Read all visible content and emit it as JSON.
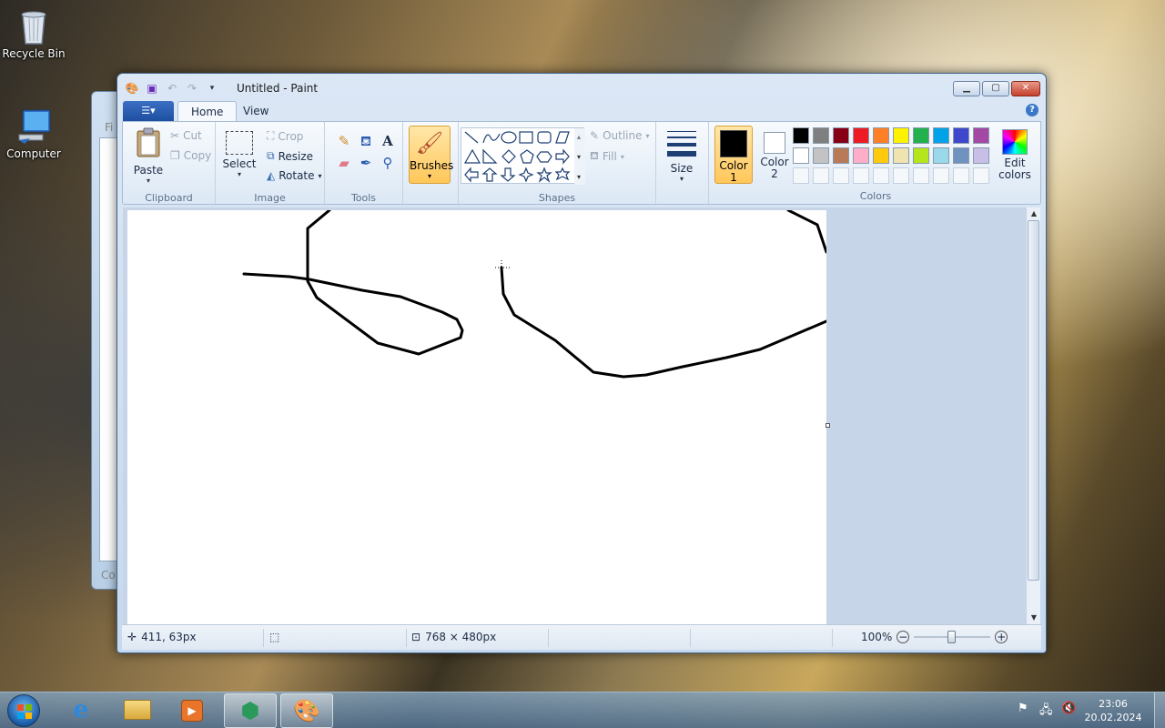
{
  "desktop": {
    "icons": [
      {
        "label": "Recycle Bin"
      },
      {
        "label": "Computer"
      }
    ]
  },
  "background_window": {
    "text_top": "Fi",
    "text_bottom": "Co"
  },
  "window": {
    "title": "Untitled - Paint",
    "tabs": [
      "Home",
      "View"
    ],
    "file_button": "☰▾",
    "help": "?"
  },
  "ribbon": {
    "clipboard": {
      "label": "Clipboard",
      "paste": "Paste",
      "cut": "Cut",
      "copy": "Copy"
    },
    "image": {
      "label": "Image",
      "select": "Select",
      "crop": "Crop",
      "resize": "Resize",
      "rotate": "Rotate"
    },
    "tools": {
      "label": "Tools"
    },
    "brushes": {
      "label": "Brushes"
    },
    "shapes": {
      "label": "Shapes",
      "outline": "Outline",
      "fill": "Fill"
    },
    "size": {
      "label": "Size"
    },
    "colors": {
      "label": "Colors",
      "color1_label": "Color\n1",
      "color1_line1": "Color",
      "color1_line2": "1",
      "color2_line1": "Color",
      "color2_line2": "2",
      "edit_line1": "Edit",
      "edit_line2": "colors",
      "color1": "#000000",
      "color2": "#ffffff",
      "palette_row1": [
        "#000000",
        "#7f7f7f",
        "#880015",
        "#ed1c24",
        "#ff7f27",
        "#fff200",
        "#22b14c",
        "#00a2e8",
        "#3f48cc",
        "#a349a4"
      ],
      "palette_row2": [
        "#ffffff",
        "#c3c3c3",
        "#b97a57",
        "#ffaec9",
        "#ffc90e",
        "#efe4b0",
        "#b5e61d",
        "#99d9ea",
        "#7092be",
        "#c8bfe7"
      ]
    }
  },
  "status": {
    "cursor_pos": "411, 63px",
    "image_size": "768 × 480px",
    "zoom": "100%",
    "zoom_level": 0.5
  },
  "taskbar": {
    "time": "23:06",
    "date": "20.02.2024"
  }
}
